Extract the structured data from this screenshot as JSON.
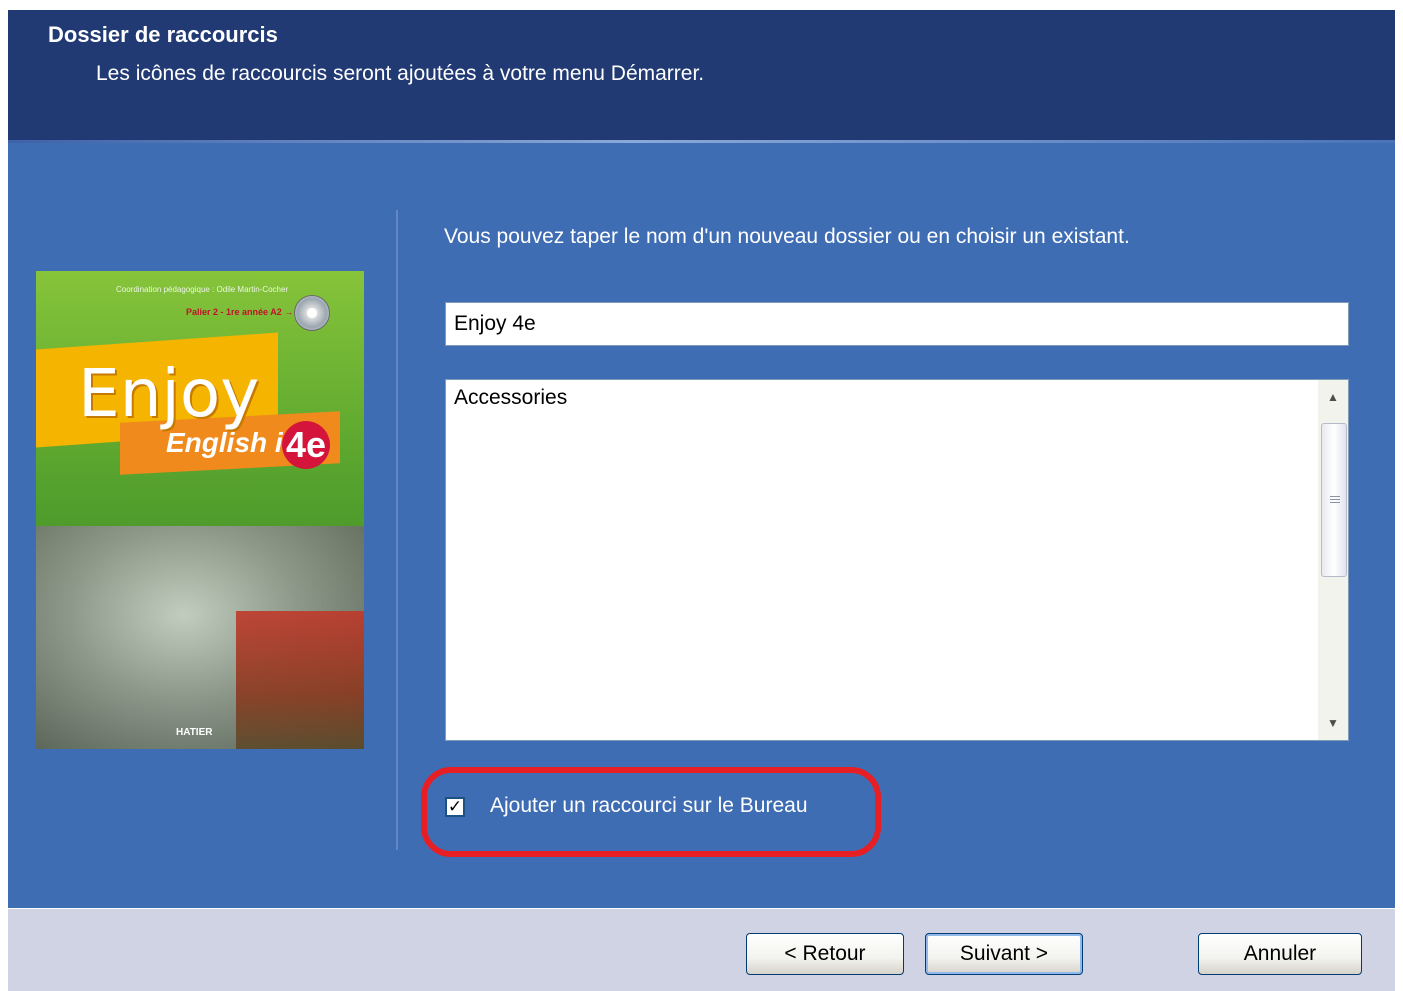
{
  "header": {
    "title": "Dossier de raccourcis",
    "subtitle": "Les icônes de raccourcis seront ajoutées à votre menu Démarrer."
  },
  "cover": {
    "top_line": "Coordination pédagogique : Odile Martin-Cocher",
    "level": "Palier 2 - 1re année A2 → B1",
    "title": "Enjoy",
    "subtitle": "English in",
    "grade": "4e",
    "publisher": "HATIER"
  },
  "main": {
    "instruction": "Vous pouvez taper le nom d'un nouveau dossier ou en choisir un existant.",
    "folder_value": "Enjoy 4e",
    "folder_list": [
      "Accessories"
    ],
    "checkbox_label": "Ajouter un raccourci sur le Bureau",
    "checkbox_checked": true
  },
  "buttons": {
    "back": "< Retour",
    "next": "Suivant >",
    "cancel": "Annuler"
  },
  "colors": {
    "header_bg": "#213a74",
    "body_bg": "#3f6db3",
    "footer_bg": "#cfd3e3",
    "highlight": "#e81e25"
  }
}
